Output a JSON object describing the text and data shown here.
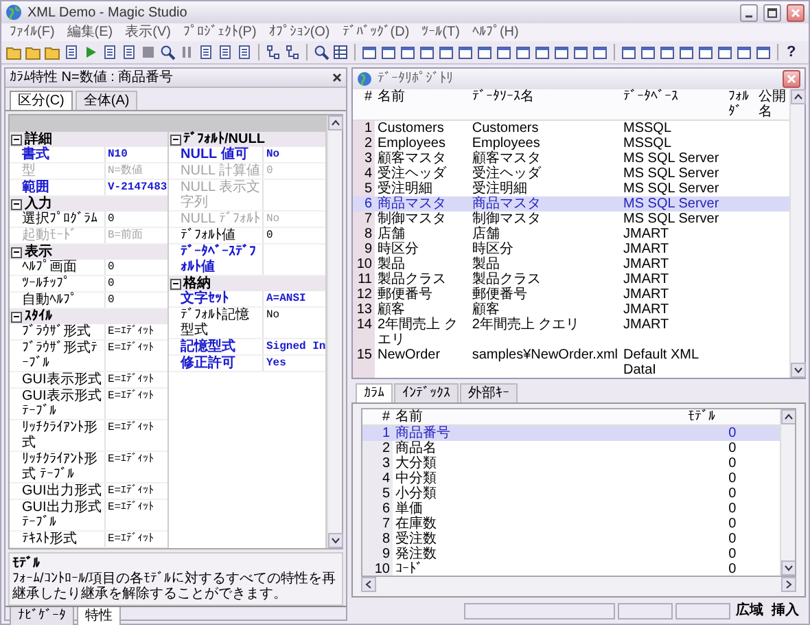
{
  "window": {
    "title": "XML Demo - Magic Studio"
  },
  "menu": [
    "ﾌｧｲﾙ(F)",
    "編集(E)",
    "表示(V)",
    "ﾌﾟﾛｼﾞｪｸﾄ(P)",
    "ｵﾌﾟｼｮﾝ(O)",
    "ﾃﾞﾊﾞｯｸﾞ(D)",
    "ﾂｰﾙ(T)",
    "ﾍﾙﾌﾟ(H)"
  ],
  "toolbar": {
    "help_label": "?"
  },
  "properties_panel": {
    "title": "ｶﾗﾑ特性 N=数値 : 商品番号",
    "tabs": [
      {
        "label": "区分(C)",
        "selected": true
      },
      {
        "label": "全体(A)",
        "selected": false
      }
    ],
    "categories": [
      {
        "name": "詳細",
        "expanded": true,
        "items": [
          {
            "name": "書式",
            "value": "N10",
            "modified": true,
            "disabled": false
          },
          {
            "name": "型",
            "value": "N=数値",
            "modified": false,
            "disabled": true
          },
          {
            "name": "範囲",
            "value": "V-2147483",
            "modified": true,
            "disabled": false
          }
        ]
      },
      {
        "name": "入力",
        "expanded": true,
        "items": [
          {
            "name": "選択ﾌﾟﾛｸﾞﾗﾑ",
            "value": "0",
            "modified": false,
            "disabled": false
          },
          {
            "name": "起動ﾓｰﾄﾞ",
            "value": "B=前面",
            "modified": false,
            "disabled": true
          }
        ]
      },
      {
        "name": "表示",
        "expanded": true,
        "items": [
          {
            "name": "ﾍﾙﾌﾟ画面",
            "value": "0",
            "modified": false,
            "disabled": false
          },
          {
            "name": "ﾂｰﾙﾁｯﾌﾟ",
            "value": "0",
            "modified": false,
            "disabled": false
          },
          {
            "name": "自動ﾍﾙﾌﾟ",
            "value": "0",
            "modified": false,
            "disabled": false
          }
        ]
      },
      {
        "name": "ｽﾀｲﾙ",
        "expanded": true,
        "items": [
          {
            "name": "ﾌﾞﾗｳｻﾞ形式",
            "value": "E=ｴﾃﾞｨｯﾄ",
            "modified": false,
            "disabled": false
          },
          {
            "name": "ﾌﾞﾗｳｻﾞ形式ﾃｰﾌﾞﾙ",
            "value": "E=ｴﾃﾞｨｯﾄ",
            "modified": false,
            "disabled": false
          },
          {
            "name": "GUI表示形式",
            "value": "E=ｴﾃﾞｨｯﾄ",
            "modified": false,
            "disabled": false
          },
          {
            "name": "GUI表示形式ﾃｰﾌﾞﾙ",
            "value": "E=ｴﾃﾞｨｯﾄ",
            "modified": false,
            "disabled": false
          },
          {
            "name": "ﾘｯﾁｸﾗｲｱﾝﾄ形式",
            "value": "E=ｴﾃﾞｨｯﾄ",
            "modified": false,
            "disabled": false
          },
          {
            "name": "ﾘｯﾁｸﾗｲｱﾝﾄ形式 ﾃｰﾌﾞﾙ",
            "value": "E=ｴﾃﾞｨｯﾄ",
            "modified": false,
            "disabled": false
          },
          {
            "name": "GUI出力形式",
            "value": "E=ｴﾃﾞｨｯﾄ",
            "modified": false,
            "disabled": false
          },
          {
            "name": "GUI出力形式ﾃｰﾌﾞﾙ",
            "value": "E=ｴﾃﾞｨｯﾄ",
            "modified": false,
            "disabled": false
          },
          {
            "name": "ﾃｷｽﾄ形式",
            "value": "E=ｴﾃﾞｨｯﾄ",
            "modified": false,
            "disabled": false
          }
        ]
      },
      {
        "name": "ﾃﾞﾌｫﾙﾄ/NULL",
        "expanded": true,
        "items": [
          {
            "name": "NULL 値可",
            "value": "No",
            "modified": true,
            "disabled": false
          },
          {
            "name": "NULL 計算値",
            "value": "0",
            "modified": false,
            "disabled": true
          },
          {
            "name": "NULL 表示文字列",
            "modified": false,
            "disabled": true
          },
          {
            "name": "NULL ﾃﾞﾌｫﾙﾄ",
            "value": "No",
            "modified": false,
            "disabled": true
          },
          {
            "name": "ﾃﾞﾌｫﾙﾄ値",
            "value": "0",
            "modified": false,
            "disabled": false
          },
          {
            "name": "ﾃﾞｰﾀﾍﾞｰｽﾃﾞﾌｫﾙﾄ値",
            "modified": true,
            "disabled": false
          }
        ]
      },
      {
        "name": "格納",
        "expanded": true,
        "items": [
          {
            "name": "文字ｾｯﾄ",
            "value": "A=ANSI",
            "modified": true,
            "disabled": false
          },
          {
            "name": "ﾃﾞﾌｫﾙﾄ記憶型式",
            "value": "No",
            "modified": false,
            "disabled": false
          },
          {
            "name": "記憶型式",
            "value": "Signed In",
            "modified": true,
            "disabled": false
          },
          {
            "name": "修正許可",
            "value": "Yes",
            "modified": true,
            "disabled": false
          }
        ]
      }
    ],
    "description": {
      "title": "ﾓﾃﾞﾙ",
      "text": "ﾌｫｰﾑ/ｺﾝﾄﾛｰﾙ/項目の各ﾓﾃﾞﾙに対するすべての特性を再継承したり継承を解除することができます。"
    },
    "bottom_tabs": [
      {
        "label": "ﾅﾋﾞｹﾞｰﾀ",
        "selected": false
      },
      {
        "label": "特性",
        "selected": true
      }
    ]
  },
  "repository": {
    "title": "ﾃﾞｰﾀﾘﾎﾟｼﾞﾄﾘ",
    "columns": [
      "#",
      "名前",
      "ﾃﾞｰﾀｿｰｽ名",
      "ﾃﾞｰﾀﾍﾞｰｽ",
      "ﾌｫﾙﾀﾞ",
      "公開名"
    ],
    "rows": [
      {
        "number": "1",
        "name": "Customers",
        "data_source": "Customers",
        "database": "MSSQL",
        "selected": false
      },
      {
        "number": "2",
        "name": "Employees",
        "data_source": "Employees",
        "database": "MSSQL",
        "selected": false
      },
      {
        "number": "3",
        "name": "顧客マスタ",
        "data_source": "顧客マスタ",
        "database": "MS SQL Server",
        "selected": false
      },
      {
        "number": "4",
        "name": "受注ヘッダ",
        "data_source": "受注ヘッダ",
        "database": "MS SQL Server",
        "selected": false
      },
      {
        "number": "5",
        "name": "受注明細",
        "data_source": "受注明細",
        "database": "MS SQL Server",
        "selected": false
      },
      {
        "number": "6",
        "name": "商品マスタ",
        "data_source": "商品マスタ",
        "database": "MS SQL Server",
        "selected": true
      },
      {
        "number": "7",
        "name": "制御マスタ",
        "data_source": "制御マスタ",
        "database": "MS SQL Server",
        "selected": false
      },
      {
        "number": "8",
        "name": "店舗",
        "data_source": "店舗",
        "database": "JMART",
        "selected": false
      },
      {
        "number": "9",
        "name": "時区分",
        "data_source": "時区分",
        "database": "JMART",
        "selected": false
      },
      {
        "number": "10",
        "name": "製品",
        "data_source": "製品",
        "database": "JMART",
        "selected": false
      },
      {
        "number": "11",
        "name": "製品クラス",
        "data_source": "製品クラス",
        "database": "JMART",
        "selected": false
      },
      {
        "number": "12",
        "name": "郵便番号",
        "data_source": "郵便番号",
        "database": "JMART",
        "selected": false
      },
      {
        "number": "13",
        "name": "顧客",
        "data_source": "顧客",
        "database": "JMART",
        "selected": false
      },
      {
        "number": "14",
        "name": "2年間売上 クエリ",
        "data_source": "2年間売上 クエリ",
        "database": "JMART",
        "selected": false
      },
      {
        "number": "15",
        "name": "NewOrder",
        "data_source": "samples¥NewOrder.xml",
        "database": "Default XML DataI",
        "selected": false
      }
    ]
  },
  "column_pane": {
    "tabs": [
      {
        "label": "ｶﾗﾑ",
        "selected": true
      },
      {
        "label": "ｲﾝﾃﾞｯｸｽ",
        "selected": false
      },
      {
        "label": "外部ｷｰ",
        "selected": false
      }
    ],
    "columns": [
      "#",
      "名前",
      "ﾓﾃﾞﾙ"
    ],
    "rows": [
      {
        "number": "1",
        "name": "商品番号",
        "model": "0",
        "selected": true
      },
      {
        "number": "2",
        "name": "商品名",
        "model": "0",
        "selected": false
      },
      {
        "number": "3",
        "name": "大分類",
        "model": "0",
        "selected": false
      },
      {
        "number": "4",
        "name": "中分類",
        "model": "0",
        "selected": false
      },
      {
        "number": "5",
        "name": "小分類",
        "model": "0",
        "selected": false
      },
      {
        "number": "6",
        "name": "単価",
        "model": "0",
        "selected": false
      },
      {
        "number": "7",
        "name": "在庫数",
        "model": "0",
        "selected": false
      },
      {
        "number": "8",
        "name": "受注数",
        "model": "0",
        "selected": false
      },
      {
        "number": "9",
        "name": "発注数",
        "model": "0",
        "selected": false
      },
      {
        "number": "10",
        "name": "ｺｰﾄﾞ",
        "model": "0",
        "selected": false
      }
    ]
  },
  "status_bar": {
    "cells": [
      "広域",
      "挿入"
    ]
  }
}
